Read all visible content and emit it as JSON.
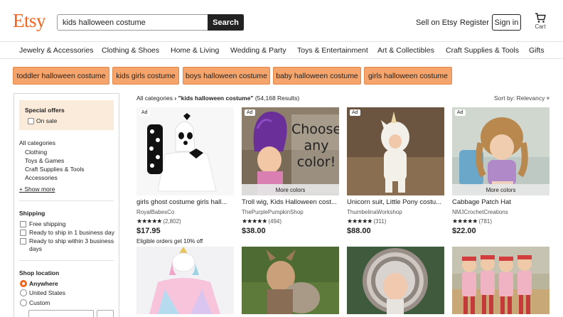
{
  "header": {
    "logo": "Etsy",
    "search_value": "kids halloween costume",
    "search_button": "Search",
    "sell_link": "Sell on Etsy",
    "register_link": "Register",
    "signin_button": "Sign in",
    "cart_label": "Cart"
  },
  "categories": [
    "Jewelry & Accessories",
    "Clothing & Shoes",
    "Home & Living",
    "Wedding & Party",
    "Toys & Entertainment",
    "Art & Collectibles",
    "Craft Supplies & Tools",
    "Gifts"
  ],
  "suggestions": [
    "toddler halloween costume",
    "kids girls costume",
    "boys halloween costume",
    "baby halloween costume",
    "girls halloween costume"
  ],
  "sidebar": {
    "offers_title": "Special offers",
    "on_sale": "On sale",
    "all_categories": "All categories",
    "category_items": [
      "Clothing",
      "Toys & Games",
      "Craft Supplies & Tools",
      "Accessories"
    ],
    "show_more": "+ Show more",
    "shipping_title": "Shipping",
    "shipping_items": [
      "Free shipping",
      "Ready to ship in 1 business day",
      "Ready to ship within 3 business",
      "days"
    ],
    "location_title": "Shop location",
    "location_items": [
      "Anywhere",
      "United States",
      "Custom"
    ]
  },
  "results": {
    "breadcrumb_root": "All categories",
    "breadcrumb_sep": "›",
    "query": "\"kids halloween costume\"",
    "count": "(54,168 Results)",
    "sort": "Sort by: Relevancy",
    "sort_caret": "▾"
  },
  "products": [
    {
      "ad": "Ad",
      "title": "girls ghost costume girls hall...",
      "shop": "RoyalBabesCo",
      "stars": "★★★★★",
      "reviews": "(2,802)",
      "price": "$17.95",
      "note": "Eligible orders get 10% off",
      "more_colors": ""
    },
    {
      "ad": "Ad",
      "title": "Troll wig, Kids Halloween cost...",
      "shop": "ThePurplePumpkinShop",
      "stars": "★★★★★",
      "reviews": "(494)",
      "price": "$38.00",
      "note": "",
      "more_colors": "More colors",
      "overlay": [
        "Choose",
        "any",
        "color!"
      ]
    },
    {
      "ad": "Ad",
      "title": "Unicorn suit, Little Pony costu...",
      "shop": "ThumbelinaWorkshop",
      "stars": "★★★★★",
      "reviews": "(311)",
      "price": "$88.00",
      "note": "",
      "more_colors": ""
    },
    {
      "ad": "Ad",
      "title": "Cabbage Patch Hat",
      "shop": "NMJCrochetCreations",
      "stars": "★★★★★",
      "reviews": "(781)",
      "price": "$22.00",
      "note": "",
      "more_colors": "More colors"
    }
  ],
  "colors": {
    "brand": "#F1641E",
    "pill": "#F5A56C",
    "offers_bg": "#FBEBDA"
  }
}
